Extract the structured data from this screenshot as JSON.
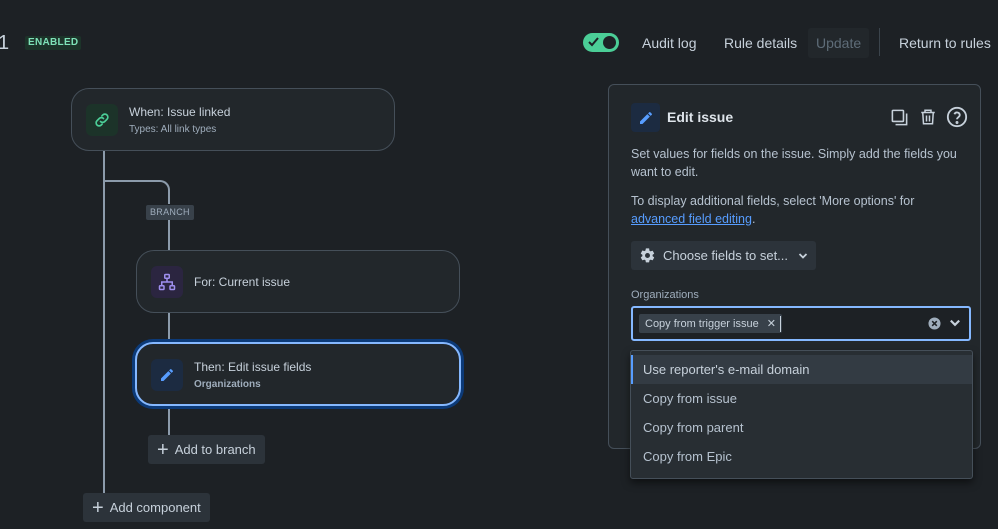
{
  "header": {
    "rule_number": "1",
    "status_badge": "ENABLED",
    "toggle_on": true,
    "audit_log": "Audit log",
    "rule_details": "Rule details",
    "update": "Update",
    "return_to_rules": "Return to rules"
  },
  "flow": {
    "trigger": {
      "title": "When: Issue linked",
      "subtitle": "Types: All link types",
      "icon": "link-icon"
    },
    "branch_label": "BRANCH",
    "branch_node": {
      "title": "For: Current issue",
      "icon": "hierarchy-icon"
    },
    "action_node": {
      "title": "Then: Edit issue fields",
      "subtitle": "Organizations",
      "icon": "pencil-icon"
    },
    "add_to_branch": "Add to branch",
    "add_component": "Add component"
  },
  "panel": {
    "title": "Edit issue",
    "description": "Set values for fields on the issue. Simply add the fields you want to edit.",
    "more_options_text": "To display additional fields, select 'More options' for",
    "advanced_link": "advanced field editing",
    "advanced_suffix": ".",
    "choose_fields": "Choose fields to set...",
    "field_label": "Organizations",
    "selected_tag": "Copy from trigger issue",
    "options": [
      "Use reporter's e-mail domain",
      "Copy from issue",
      "Copy from parent",
      "Copy from Epic"
    ]
  },
  "colors": {
    "background": "#1d2125",
    "accent": "#579dff",
    "success": "#4bce97"
  }
}
